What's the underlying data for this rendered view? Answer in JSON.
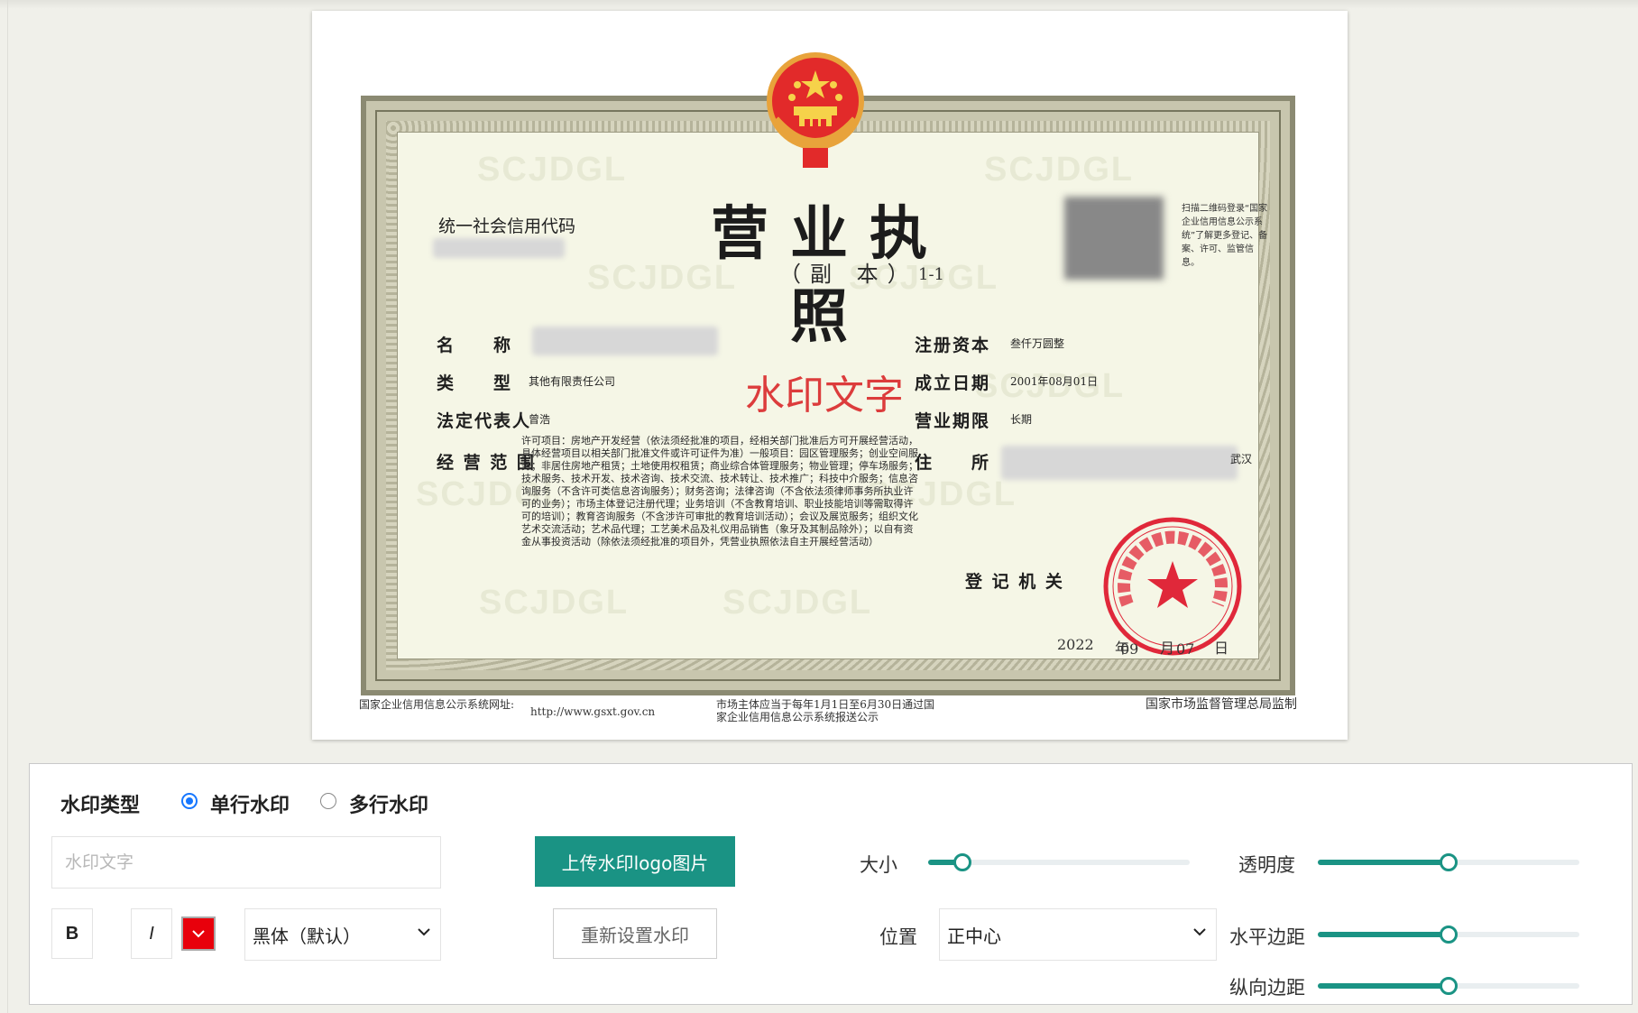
{
  "certificate": {
    "credit_code_label": "统一社会信用代码",
    "title": "营业执照",
    "subtitle": "（副  本）",
    "copy_number": "1-1",
    "qr_note": "扫描二维码登录“国家企业信用信息公示系统”了解更多登记、备案、许可、监管信息。",
    "bg_word": "SCJDGL",
    "name_label": "名　　称",
    "type_label": "类　　型",
    "type_value": "其他有限责任公司",
    "rep_label": "法定代表人",
    "rep_value": "曾浩",
    "scope_label": "经 营 范 围",
    "scope_text": "许可项目：房地产开发经营（依法须经批准的项目，经相关部门批准后方可开展经营活动，具体经营项目以相关部门批准文件或许可证件为准）一般项目：园区管理服务；创业空间服务；非居住房地产租赁；土地使用权租赁；商业综合体管理服务；物业管理；停车场服务；技术服务、技术开发、技术咨询、技术交流、技术转让、技术推广；科技中介服务；信息咨询服务（不含许可类信息咨询服务）；财务咨询；法律咨询（不含依法须律师事务所执业许可的业务）；市场主体登记注册代理；业务培训（不含教育培训、职业技能培训等需取得许可的培训）；教育咨询服务（不含涉许可审批的教育培训活动）；会议及展览服务；组织文化艺术交流活动；艺术品代理；工艺美术品及礼仪用品销售（象牙及其制品除外）；以自有资金从事投资活动（除依法须经批准的项目外，凭营业执照依法自主开展经营活动）",
    "capital_label": "注册资本",
    "capital_value": "叁仟万圆整",
    "founded_label": "成立日期",
    "founded_value": "2001年08月01日",
    "term_label": "营业期限",
    "term_value": "长期",
    "address_label": "住　　所",
    "address_tail": "武汉",
    "authority_label": "登 记 机 关",
    "seal_text": "武汉市市场监督管理局",
    "date_year": "2022",
    "date_year_unit": "年",
    "date_month": "09",
    "date_month_unit": "月",
    "date_day": "07",
    "date_day_unit": "日",
    "footer_site_label": "国家企业信用信息公示系统网址:",
    "footer_site_url": "http://www.gsxt.gov.cn",
    "footer_notice": "市场主体应当于每年1月1日至6月30日通过国家企业信用信息公示系统报送公示",
    "footer_supervisor": "国家市场监督管理总局监制"
  },
  "watermark_preview": {
    "text": "水印文字",
    "color": "#dc3c3c"
  },
  "controls": {
    "type_label": "水印类型",
    "single_label": "单行水印",
    "multi_label": "多行水印",
    "selected_type": "single",
    "text_placeholder": "水印文字",
    "bold_label": "B",
    "italic_label": "I",
    "font_color": "#e8000b",
    "font_select": "黑体（默认）",
    "upload_button": "上传水印logo图片",
    "reset_button": "重新设置水印",
    "size_label": "大小",
    "size_value": 0.13,
    "opacity_label": "透明度",
    "opacity_value": 0.5,
    "position_label": "位置",
    "position_value": "正中心",
    "h_margin_label": "水平边距",
    "h_margin_value": 0.5,
    "v_margin_label": "纵向边距",
    "v_margin_value": 0.5,
    "accent": "#1a9384"
  }
}
